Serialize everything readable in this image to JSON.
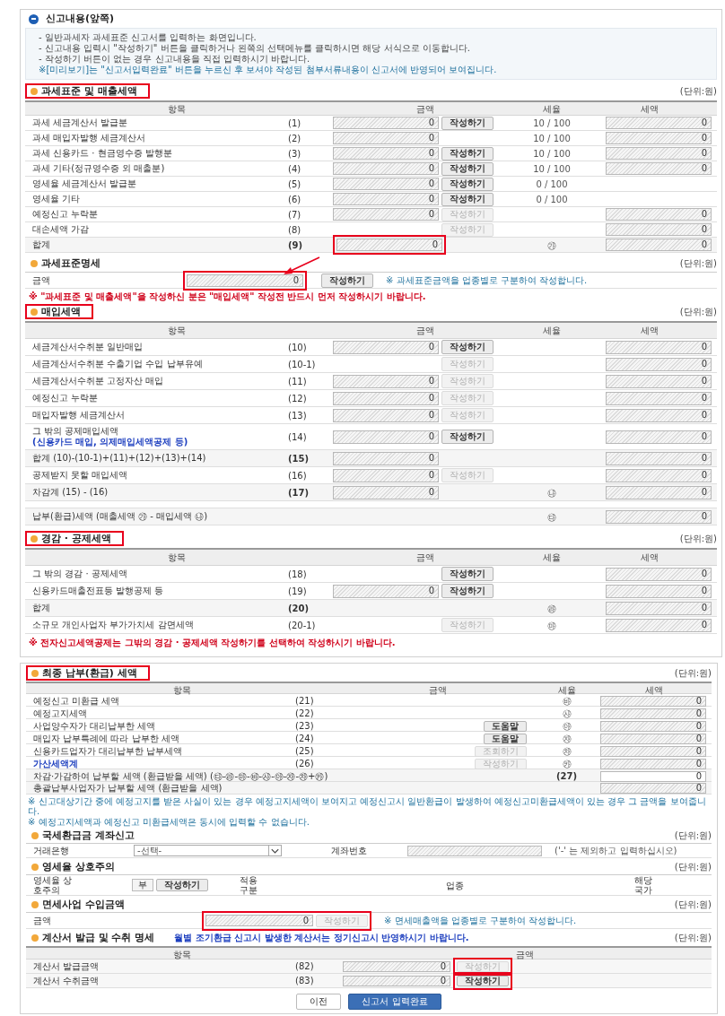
{
  "panel_title": "신고내용(앞쪽)",
  "notices": [
    {
      "kind": "plain",
      "text": "- 일반과세자 과세표준 신고서를 입력하는 화면입니다."
    },
    {
      "kind": "plain",
      "text": "- 신고내용 입력시 \"작성하기\" 버튼을 클릭하거나 왼쪽의 선택메뉴를 클릭하시면 해당 서식으로 이동합니다."
    },
    {
      "kind": "plain",
      "text": "- 작성하기 버튼이 없는 경우 신고내용을 직접 입력하시기 바랍니다."
    },
    {
      "kind": "info",
      "text": "※[미리보기]는 \"신고서입력완료\" 버튼을 누르신 후 보셔야 작성된 첨부서류내용이 신고서에 반영되어 보여집니다."
    }
  ],
  "sales": {
    "title": {
      "text": "과세표준 및 매출세액",
      "highlighted": true
    },
    "unit": "(단위:원)",
    "columns": [
      "항목",
      "금액",
      "세율",
      "세액"
    ],
    "rows": [
      {
        "kind": "item",
        "label": "과세 세금계산서 발급분",
        "no": "(1)",
        "amount": {
          "value": "0",
          "locked": true
        },
        "button": {
          "label": "작성하기",
          "disabled": false
        },
        "rate": "10 / 100",
        "tax": {
          "value": "0",
          "locked": true
        }
      },
      {
        "kind": "item",
        "label": "과세 매입자발행 세금계산서",
        "no": "(2)",
        "amount": {
          "value": "0",
          "locked": true
        },
        "rate": "10 / 100",
        "tax": {
          "value": "0",
          "locked": true
        }
      },
      {
        "kind": "item",
        "label": "과세 신용카드 · 현금영수증 발행분",
        "no": "(3)",
        "amount": {
          "value": "0",
          "locked": true
        },
        "button": {
          "label": "작성하기",
          "disabled": false
        },
        "rate": "10 / 100",
        "tax": {
          "value": "0",
          "locked": true
        }
      },
      {
        "kind": "item",
        "label": "과세 기타(정규영수증 외 매출분)",
        "no": "(4)",
        "amount": {
          "value": "0",
          "locked": true
        },
        "button": {
          "label": "작성하기",
          "disabled": false
        },
        "rate": "10 / 100",
        "tax": {
          "value": "0",
          "locked": true
        }
      },
      {
        "kind": "item",
        "label": "영세율 세금계산서 발급분",
        "no": "(5)",
        "amount": {
          "value": "0",
          "locked": true
        },
        "button": {
          "label": "작성하기",
          "disabled": false
        },
        "rate": "0 / 100"
      },
      {
        "kind": "item",
        "label": "영세율 기타",
        "no": "(6)",
        "amount": {
          "value": "0",
          "locked": true
        },
        "button": {
          "label": "작성하기",
          "disabled": false
        },
        "rate": "0 / 100"
      },
      {
        "kind": "item",
        "label": "예정신고 누락분",
        "no": "(7)",
        "amount": {
          "value": "0",
          "locked": true
        },
        "button": {
          "label": "작성하기",
          "disabled": true
        },
        "tax": {
          "value": "0",
          "locked": true
        }
      },
      {
        "kind": "item",
        "label": "대손세액 가감",
        "no": "(8)",
        "button": {
          "label": "작성하기",
          "disabled": true
        },
        "tax": {
          "value": "0",
          "locked": true
        }
      },
      {
        "kind": "total",
        "label": "합계",
        "no": "(9)",
        "amount": {
          "value": "0",
          "locked": true,
          "highlighted": true
        },
        "rate": "㉮",
        "tax": {
          "value": "0",
          "locked": true
        }
      }
    ]
  },
  "base": {
    "title": {
      "text": "과세표준명세",
      "highlighted": false
    },
    "unit": "(단위:원)",
    "label": "금액",
    "amount": {
      "value": "0",
      "locked": true,
      "highlighted": true
    },
    "button": {
      "label": "작성하기",
      "disabled": false
    },
    "note": "※ 과세표준금액을 업종별로 구분하여 작성합니다.",
    "warning": "※ \"과세표준 및 매출세액\"을 작성하신 분은 \"매입세액\" 작성전 반드시 먼저 작성하시기 바랍니다."
  },
  "purchase": {
    "title": {
      "text": "매입세액",
      "highlighted": true
    },
    "unit": "(단위:원)",
    "columns": [
      "항목",
      "금액",
      "세율",
      "세액"
    ],
    "rows": [
      {
        "kind": "item",
        "label": "세금계산서수취분 일반매입",
        "no": "(10)",
        "amount": {
          "value": "0",
          "locked": true
        },
        "button": {
          "label": "작성하기",
          "disabled": false
        },
        "tax": {
          "value": "0",
          "locked": true
        }
      },
      {
        "kind": "item",
        "label": "세금계산서수취분 수출기업 수입 납부유예",
        "no": "(10-1)",
        "button": {
          "label": "작성하기",
          "disabled": true
        },
        "tax": {
          "value": "0",
          "locked": true
        }
      },
      {
        "kind": "item",
        "label": "세금계산서수취분 고정자산 매입",
        "no": "(11)",
        "amount": {
          "value": "0",
          "locked": true
        },
        "button": {
          "label": "작성하기",
          "disabled": true
        },
        "tax": {
          "value": "0",
          "locked": true
        }
      },
      {
        "kind": "item",
        "label": "예정신고 누락분",
        "no": "(12)",
        "amount": {
          "value": "0",
          "locked": true
        },
        "button": {
          "label": "작성하기",
          "disabled": true
        },
        "tax": {
          "value": "0",
          "locked": true
        }
      },
      {
        "kind": "item",
        "label": "매입자발행 세금계산서",
        "no": "(13)",
        "amount": {
          "value": "0",
          "locked": true
        },
        "button": {
          "label": "작성하기",
          "disabled": true
        },
        "tax": {
          "value": "0",
          "locked": true
        }
      },
      {
        "kind": "item",
        "label": "그 밖의 공제매입세액",
        "sublabel": "(신용카드 매입, 의제매입세액공제 등)",
        "no": "(14)",
        "amount": {
          "value": "0",
          "locked": true
        },
        "button": {
          "label": "작성하기",
          "disabled": false
        },
        "tax": {
          "value": "0",
          "locked": true
        }
      },
      {
        "kind": "total",
        "label": "합계 (10)-(10-1)+(11)+(12)+(13)+(14)",
        "no": "(15)",
        "amount": {
          "value": "0",
          "locked": true
        },
        "tax": {
          "value": "0",
          "locked": true
        }
      },
      {
        "kind": "item",
        "label": "공제받지 못할 매입세액",
        "no": "(16)",
        "amount": {
          "value": "0",
          "locked": true
        },
        "button": {
          "label": "작성하기",
          "disabled": true
        },
        "tax": {
          "value": "0",
          "locked": true
        }
      },
      {
        "kind": "total",
        "label": "차감계 (15) - (16)",
        "no": "(17)",
        "amount": {
          "value": "0",
          "locked": true
        },
        "rate": "㉯",
        "tax": {
          "value": "0",
          "locked": true
        }
      }
    ],
    "summary": {
      "kind": "wide",
      "label": "납부(환급)세액 (매출세액 ㉮ - 매입세액 ㉯)",
      "rate": "㉰",
      "tax": {
        "value": "0",
        "locked": true
      }
    }
  },
  "deduction": {
    "title": {
      "text": "경감 · 공제세액",
      "highlighted": true
    },
    "unit": "(단위:원)",
    "columns": [
      "항목",
      "금액",
      "세율",
      "세액"
    ],
    "rows": [
      {
        "kind": "item",
        "label": "그 밖의 경감 · 공제세액",
        "no": "(18)",
        "button": {
          "label": "작성하기",
          "disabled": false
        },
        "tax": {
          "value": "0",
          "locked": true
        }
      },
      {
        "kind": "item",
        "label": "신용카드매출전표등 발행공제 등",
        "no": "(19)",
        "amount": {
          "value": "0",
          "locked": true
        },
        "button": {
          "label": "작성하기",
          "disabled": false
        },
        "tax": {
          "value": "0",
          "locked": true
        }
      },
      {
        "kind": "total",
        "label": "합계",
        "no": "(20)",
        "rate": "㉱",
        "tax": {
          "value": "0",
          "locked": true
        }
      },
      {
        "kind": "item",
        "label": "소규모 개인사업자 부가가치세 감면세액",
        "no": "(20-1)",
        "button": {
          "label": "작성하기",
          "disabled": true
        },
        "rate": "㉲",
        "tax": {
          "value": "0",
          "locked": true
        }
      }
    ],
    "warning": "※ 전자신고세액공제는 그밖의 경감 · 공제세액 작성하기를 선택하여 작성하시기 바랍니다."
  },
  "final": {
    "title": {
      "text": "최종 납부(환급) 세액",
      "highlighted": true
    },
    "unit": "(단위:원)",
    "columns": [
      "항목",
      "금액",
      "세율",
      "세액"
    ],
    "rows": [
      {
        "kind": "item",
        "label": "예정신고 미환급 세액",
        "no": "(21)",
        "rate": "㉳",
        "tax": {
          "value": "0",
          "locked": true
        }
      },
      {
        "kind": "item",
        "label": "예정고지세액",
        "no": "(22)",
        "rate": "㉴",
        "tax": {
          "value": "0",
          "locked": true
        }
      },
      {
        "kind": "item",
        "label": "사업양수자가 대리납부한 세액",
        "no": "(23)",
        "button": {
          "label": "도움말",
          "disabled": false
        },
        "rate": "㉵",
        "tax": {
          "value": "0",
          "locked": true
        }
      },
      {
        "kind": "item",
        "label": "매입자 납부특례에 따라 납부한 세액",
        "no": "(24)",
        "button": {
          "label": "도움말",
          "disabled": false
        },
        "rate": "㉶",
        "tax": {
          "value": "0",
          "locked": true
        }
      },
      {
        "kind": "item",
        "label": "신용카드업자가 대리납부한 납부세액",
        "no": "(25)",
        "button": {
          "label": "조회하기",
          "disabled": true
        },
        "rate": "㉷",
        "tax": {
          "value": "0",
          "locked": true
        }
      },
      {
        "kind": "link",
        "label": "가산세액계",
        "no": "(26)",
        "button": {
          "label": "작성하기",
          "disabled": true
        },
        "rate": "㉸",
        "tax": {
          "value": "0",
          "locked": true
        }
      },
      {
        "kind": "wide",
        "label": "차감·가감하여 납부할 세액 (환급받을 세액) (㉰-㉱-㉲-㉳-㉴-㉵-㉶-㉷+㉸)",
        "ref": "(27)",
        "tax": {
          "value": "0",
          "locked": false
        }
      },
      {
        "kind": "wide",
        "label": "총괄납부사업자가 납부할 세액 (환급받을 세액)",
        "tax": {
          "value": "0",
          "locked": true
        }
      }
    ],
    "notes": [
      "※ 신고대상기간 중에 예정고지를 받은 사실이 있는 경우 예정고지세액이 보여지고 예정신고시 일반환급이 발생하여 예정신고미환급세액이 있는 경우 그 금액을 보여줍니다.",
      "※ 예정고지세액과 예정신고 미환급세액은 동시에 입력할 수 없습니다."
    ]
  },
  "refund_account": {
    "title": {
      "text": "국세환급금 계좌신고",
      "highlighted": false
    },
    "unit": "(단위:원)",
    "bank_label": "거래은행",
    "bank_select": "-선택-",
    "account_label": "계좌번호",
    "account_field": {
      "locked": true
    },
    "hint": "('-' 는 제외하고 입력하십시오)"
  },
  "zero_rate": {
    "title": {
      "text": "영세율 상호주의",
      "highlighted": false
    },
    "unit": "(단위:원)",
    "label": "영세율 상호주의",
    "toggle": "부",
    "button": {
      "label": "작성하기",
      "disabled": false
    },
    "apply_label": "적용 구분",
    "industry_label": "업종",
    "country_label": "해당 국가"
  },
  "exempt": {
    "title": {
      "text": "면세사업 수입금액",
      "highlighted": false
    },
    "unit": "(단위:원)",
    "label": "금액",
    "highlighted": true,
    "amount": {
      "value": "0",
      "locked": true
    },
    "button": {
      "label": "작성하기",
      "disabled": true
    },
    "note": "※ 면세매출액을 업종별로 구분하여 작성합니다."
  },
  "invoices": {
    "title": {
      "text": "계산서 발급 및 수취 명세",
      "highlighted": false
    },
    "note": "월별 조기환급 신고시 발생한 계산서는 정기신고시 반영하시기 바랍니다.",
    "unit": "(단위:원)",
    "columns": [
      "항목",
      "금액"
    ],
    "rows": [
      {
        "label": "계산서 발급금액",
        "no": "(82)",
        "amount": {
          "value": "0",
          "locked": true
        },
        "button": {
          "label": "작성하기",
          "disabled": true,
          "highlighted": true
        }
      },
      {
        "label": "계산서 수취금액",
        "no": "(83)",
        "amount": {
          "value": "0",
          "locked": true
        },
        "button": {
          "label": "작성하기",
          "disabled": false,
          "highlighted": true
        }
      }
    ]
  },
  "actions": [
    {
      "label": "이전",
      "kind": "secondary"
    },
    {
      "label": "신고서 입력완료",
      "kind": "primary"
    }
  ]
}
